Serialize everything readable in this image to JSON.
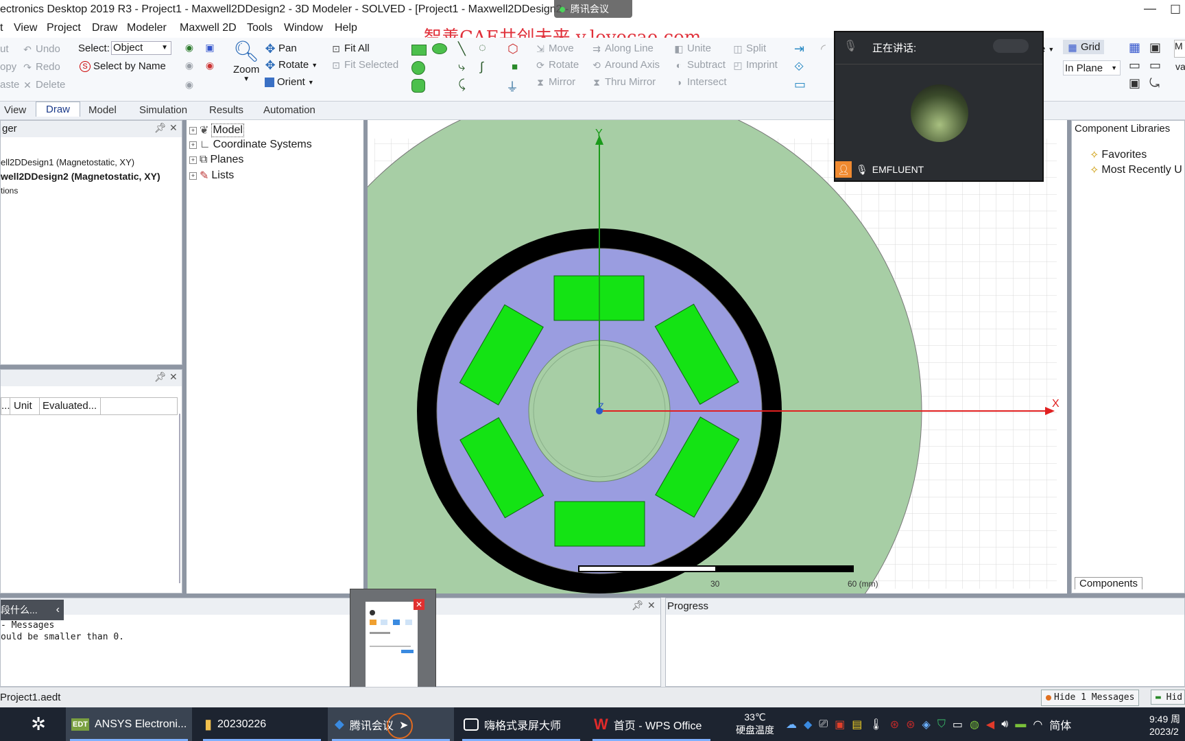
{
  "title_bar": {
    "title": "ectronics Desktop 2019 R3 - Project1 - Maxwell2DDesign2 - 3D Modeler - SOLVED - [Project1 - Maxwell2DDesign2 - M",
    "meeting_tag": "腾讯会议",
    "minimize": "—"
  },
  "watermark": "智善CAE共创未来 v.lovecae.com",
  "menu": [
    "t",
    "View",
    "Project",
    "Draw",
    "Modeler",
    "Maxwell 2D",
    "Tools",
    "Window",
    "Help"
  ],
  "ribbon": {
    "edit": {
      "cut": "ut",
      "copy": "opy",
      "paste": "aste",
      "undo": "Undo",
      "redo": "Redo",
      "delete": "Delete"
    },
    "select_label": "Select:",
    "select_value": "Object",
    "select_by_name": "Select by Name",
    "zoom": "Zoom",
    "pan": "Pan",
    "rotate": "Rotate",
    "orient": "Orient",
    "fit_all": "Fit All",
    "fit_selected": "Fit Selected",
    "move": "Move",
    "rotate2": "Rotate",
    "mirror": "Mirror",
    "along_line": "Along Line",
    "around_axis": "Around Axis",
    "thru_mirror": "Thru Mirror",
    "unite": "Unite",
    "subtract": "Subtract",
    "intersect": "Intersect",
    "split": "Split",
    "imprint": "Imprint",
    "grid": "Grid",
    "in_plane": "In Plane",
    "dropdown_e": "e",
    "right_m": "M",
    "right_va": "va"
  },
  "tabs": [
    "View",
    "Draw",
    "Model",
    "Simulation",
    "Results",
    "Automation"
  ],
  "project_manager": {
    "header": "ger",
    "items": [
      "ell2DDesign1 (Magnetostatic, XY)",
      "well2DDesign2 (Magnetostatic, XY)",
      "tions"
    ]
  },
  "properties": {
    "columns": [
      "...",
      "Unit",
      "Evaluated..."
    ]
  },
  "model_tree": [
    "Model",
    "Coordinate Systems",
    "Planes",
    "Lists"
  ],
  "canvas": {
    "axis_y": "Y",
    "axis_x": "X",
    "axis_z": "Z",
    "scale_30": "30",
    "scale_60": "60 (mm)"
  },
  "component_libraries": {
    "header": "Component Libraries",
    "items": [
      "Favorites",
      "Most Recently U"
    ],
    "tab": "Components"
  },
  "messages": {
    "header_partial": "段什么...",
    "line1": "- Messages",
    "line2": "ould be smaller than 0."
  },
  "progress": {
    "header": "Progress"
  },
  "status": {
    "project": "Project1.aedt",
    "hide_messages": "Hide 1 Messages",
    "hide2": "Hid"
  },
  "video": {
    "speaking_label": "正在讲话:",
    "participant": "EMFLUENT"
  },
  "taskbar": {
    "items": [
      "ANSYS Electroni...",
      "20230226",
      "腾讯会议",
      "嗨格式录屏大师",
      "首页 - WPS Office"
    ],
    "temp": "33℃",
    "temp_label": "硬盘温度",
    "ime": "简体",
    "time": "9:49 周",
    "date": "2023/2"
  }
}
